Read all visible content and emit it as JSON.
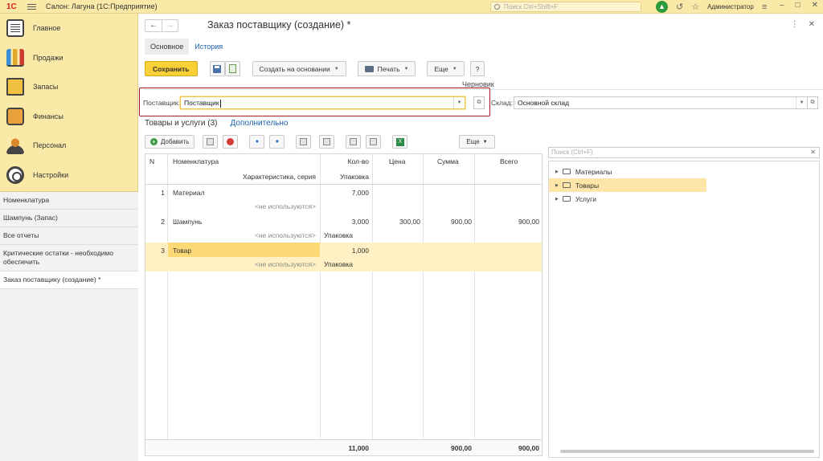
{
  "app": {
    "logo_text": "1С",
    "title": "Салон: Лагуна  (1С:Предприятие)",
    "search_placeholder": "Поиск Ctrl+Shift+F",
    "user": "Администратор"
  },
  "sidebar": {
    "items": [
      {
        "label": "Главное",
        "icon": "journal-icon"
      },
      {
        "label": "Продажи",
        "icon": "sales-chart-icon"
      },
      {
        "label": "Запасы",
        "icon": "stock-icon"
      },
      {
        "label": "Финансы",
        "icon": "wallet-icon"
      },
      {
        "label": "Персонал",
        "icon": "staff-icon"
      },
      {
        "label": "Настройки",
        "icon": "gear-icon"
      }
    ],
    "history": [
      "Номенклатура",
      "Шампунь (Запас)",
      "Все отчеты",
      "Критические остатки - необходимо обеспечить",
      "Заказ поставщику (создание) *"
    ]
  },
  "document": {
    "title": "Заказ поставщику (создание) *",
    "tabs": [
      "Основное",
      "История"
    ],
    "toolbar": {
      "save": "Сохранить",
      "create_based": "Создать на основании",
      "print": "Печать",
      "more": "Еще",
      "help": "?"
    },
    "status": "Черновик",
    "supplier_label": "Поставщик:",
    "supplier_value": "Поставщик",
    "warehouse_label": "Склад:",
    "warehouse_value": "Основной склад",
    "subtabs": [
      "Товары и услуги (3)",
      "Дополнительно"
    ],
    "table_toolbar": {
      "add": "Добавить",
      "more": "Еще"
    }
  },
  "grid": {
    "headers": {
      "n": "N",
      "nomenclature": "Номенклатура",
      "characteristic": "Характеристика, серия",
      "qty": "Кол-во",
      "package": "Упаковка",
      "price": "Цена",
      "sum": "Сумма",
      "total": "Всего"
    },
    "rows": [
      {
        "n": "1",
        "name": "Материал",
        "char": "<не используются>",
        "qty": "7,000",
        "pack": "",
        "price": "",
        "sum": "",
        "total": ""
      },
      {
        "n": "2",
        "name": "Шампунь",
        "char": "<не используются>",
        "qty": "3,000",
        "pack": "Упаковка",
        "price": "300,00",
        "sum": "900,00",
        "total": "900,00"
      },
      {
        "n": "3",
        "name": "Товар",
        "char": "<не используются>",
        "qty": "1,000",
        "pack": "Упаковка",
        "price": "",
        "sum": "",
        "total": ""
      }
    ],
    "footer": {
      "qty": "11,000",
      "sum": "900,00",
      "total": "900,00"
    }
  },
  "tree": {
    "search_placeholder": "Поиск (Ctrl+F)",
    "items": [
      "Материалы",
      "Товары",
      "Услуги"
    ],
    "selected": "Товары"
  }
}
